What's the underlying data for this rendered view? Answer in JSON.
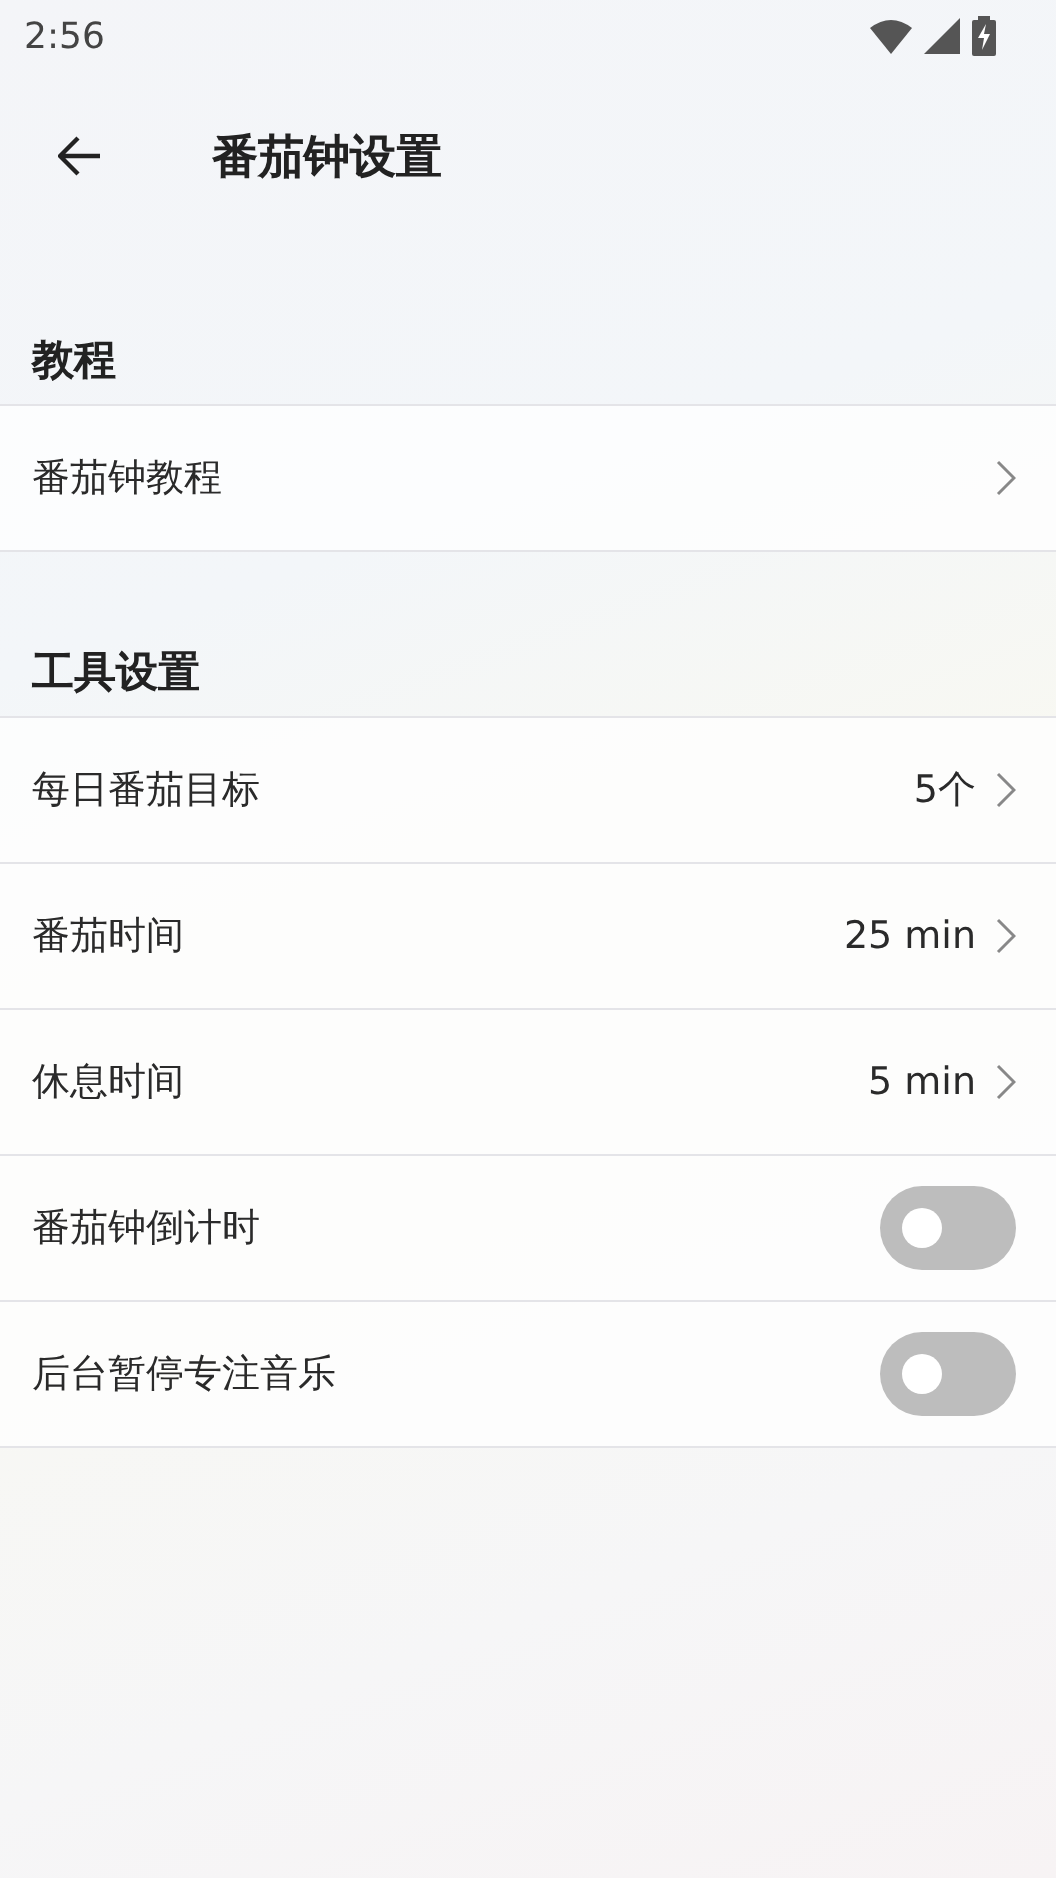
{
  "status_bar": {
    "time": "2:56"
  },
  "app_bar": {
    "title": "番茄钟设置"
  },
  "sections": [
    {
      "title": "教程",
      "rows": [
        {
          "kind": "link",
          "label": "番茄钟教程"
        }
      ]
    },
    {
      "title": "工具设置",
      "rows": [
        {
          "kind": "link",
          "label": "每日番茄目标",
          "value": "5个"
        },
        {
          "kind": "link",
          "label": "番茄时间",
          "value": "25 min"
        },
        {
          "kind": "link",
          "label": "休息时间",
          "value": "5 min"
        },
        {
          "kind": "switch",
          "label": "番茄钟倒计时",
          "on": false
        },
        {
          "kind": "switch",
          "label": "后台暂停专注音乐",
          "on": false
        }
      ]
    }
  ]
}
